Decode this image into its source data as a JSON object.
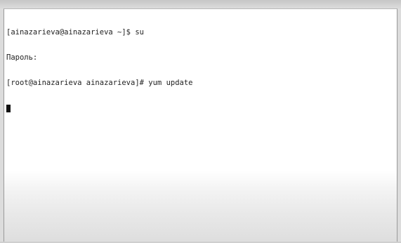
{
  "terminal": {
    "lines": [
      "[ainazarieva@ainazarieva ~]$ su",
      "Пароль:",
      "[root@ainazarieva ainazarieva]# yum update"
    ],
    "cursor": "block-cursor"
  }
}
